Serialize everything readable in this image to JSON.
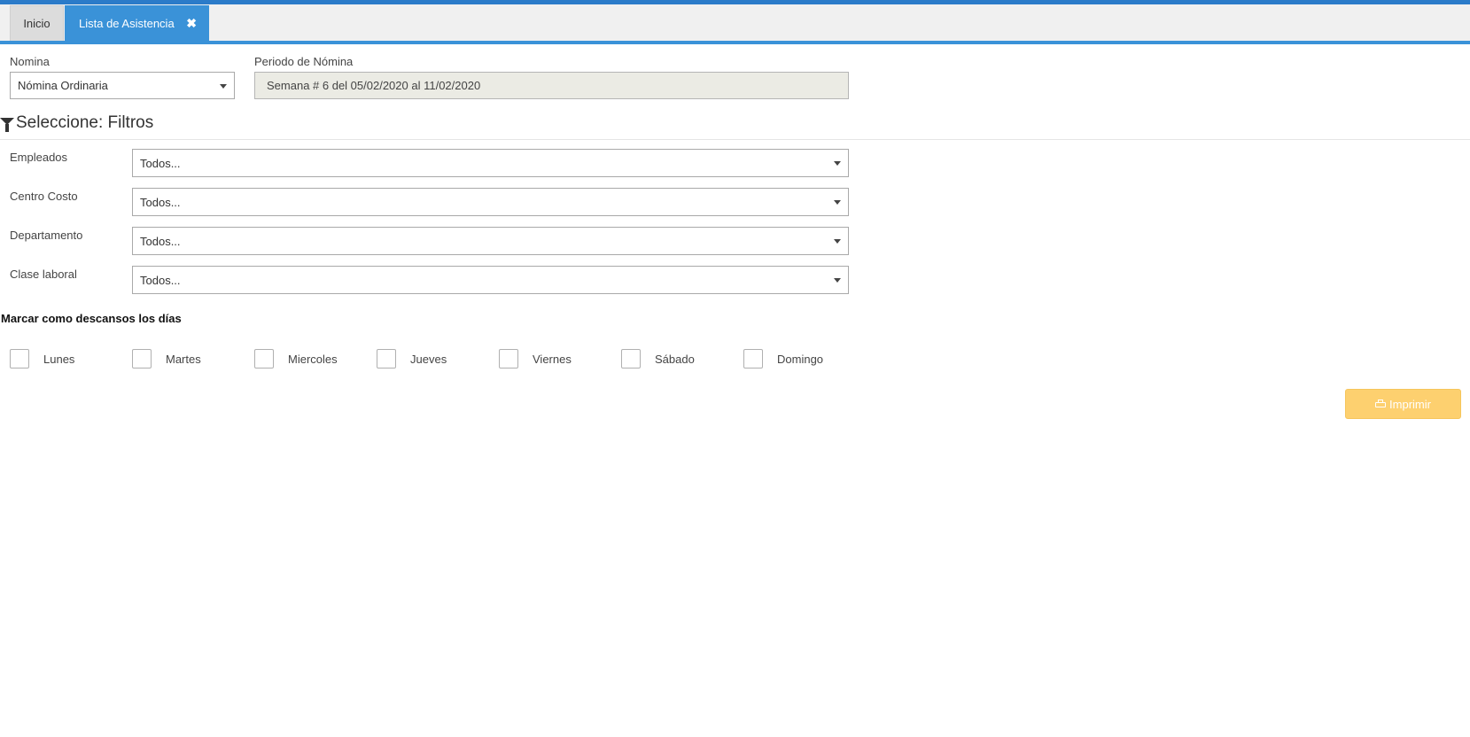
{
  "tabs": {
    "home_label": "Inicio",
    "active_label": "Lista de Asistencia",
    "close_glyph": "✖"
  },
  "nomina": {
    "label": "Nomina",
    "value": "Nómina Ordinaria"
  },
  "periodo": {
    "label": "Periodo de Nómina",
    "value": "Semana # 6 del 05/02/2020 al 11/02/2020"
  },
  "filters": {
    "title": "Seleccione: Filtros",
    "items": [
      {
        "label": "Empleados",
        "value": "Todos..."
      },
      {
        "label": "Centro Costo",
        "value": "Todos..."
      },
      {
        "label": "Departamento",
        "value": "Todos..."
      },
      {
        "label": "Clase laboral",
        "value": "Todos..."
      }
    ]
  },
  "rest_days": {
    "title": "Marcar como descansos los días",
    "days": [
      "Lunes",
      "Martes",
      "Miercoles",
      "Jueves",
      "Viernes",
      "Sábado",
      "Domingo"
    ]
  },
  "actions": {
    "print_label": "Imprimir",
    "print_color": "#fdd06f"
  },
  "colors": {
    "accent": "#3a92d8",
    "top_bar": "#2b7bc9"
  }
}
